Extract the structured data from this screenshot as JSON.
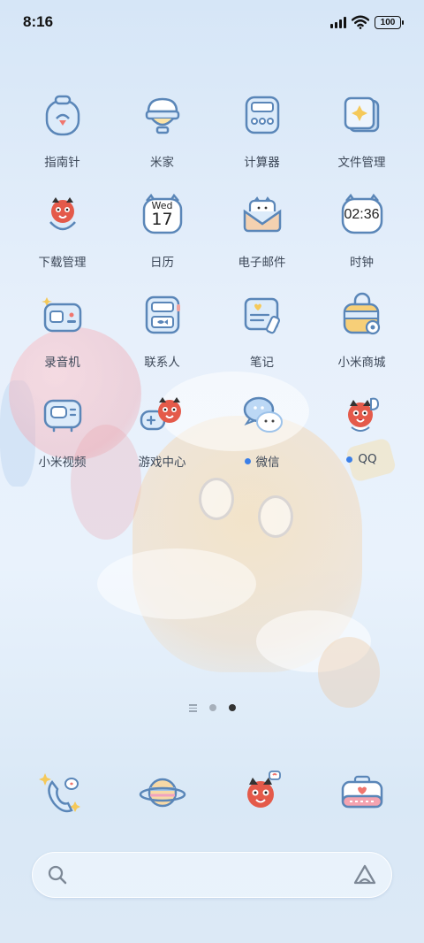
{
  "status_bar": {
    "time": "8:16",
    "battery_level": "100",
    "signal_icon": "signal-bars-icon",
    "wifi_icon": "wifi-icon"
  },
  "apps": [
    {
      "label": "指南针",
      "icon": "compass-icon"
    },
    {
      "label": "米家",
      "icon": "mi-home-icon"
    },
    {
      "label": "计算器",
      "icon": "calculator-icon"
    },
    {
      "label": "文件管理",
      "icon": "file-manager-icon"
    },
    {
      "label": "下载管理",
      "icon": "download-manager-icon"
    },
    {
      "label": "日历",
      "icon": "calendar-icon",
      "weekday": "Wed",
      "day": "17"
    },
    {
      "label": "电子邮件",
      "icon": "email-icon"
    },
    {
      "label": "时钟",
      "icon": "clock-icon",
      "time_text": "02:36"
    },
    {
      "label": "录音机",
      "icon": "recorder-icon"
    },
    {
      "label": "联系人",
      "icon": "contacts-icon"
    },
    {
      "label": "笔记",
      "icon": "notes-icon"
    },
    {
      "label": "小米商城",
      "icon": "mi-store-icon"
    },
    {
      "label": "小米视频",
      "icon": "mi-video-icon"
    },
    {
      "label": "游戏中心",
      "icon": "game-center-icon"
    },
    {
      "label": "微信",
      "icon": "wechat-icon",
      "new_badge": true
    },
    {
      "label": "QQ",
      "icon": "qq-icon",
      "new_badge": true
    }
  ],
  "page_indicator": {
    "pages": 2,
    "active_index": 1
  },
  "dock": [
    {
      "icon": "phone-icon"
    },
    {
      "icon": "browser-icon"
    },
    {
      "icon": "messages-icon"
    },
    {
      "icon": "camera-icon"
    }
  ],
  "search": {
    "placeholder": "",
    "search_icon": "search-icon",
    "assistant_icon": "ai-assistant-icon"
  },
  "colors": {
    "icon_outline": "#5a86b8",
    "icon_fill": "#dcebfa",
    "badge_dot": "#3b7fe8"
  }
}
